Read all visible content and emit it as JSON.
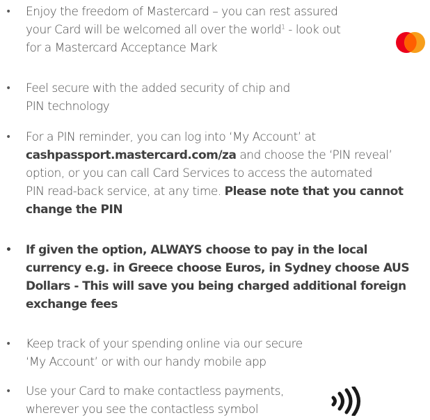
{
  "items": [
    {
      "lines": [
        "Enjoy the freedom of Mastercard – you can rest assured",
        "your Card will be welcomed all over the world",
        "for a Mastercard Acceptance Mark"
      ],
      "sup": "1",
      "after_sup": " - look out"
    },
    {
      "lines": [
        "Feel secure with the added security of chip and",
        "PIN technology"
      ]
    },
    {
      "line1": "For a PIN reminder, you can log into ‘My Account’ at",
      "link": "cashpassport.mastercard.com/za",
      "line2_rest": " and choose the ‘PIN reveal’",
      "line3": "option, or you can call Card Services to access the automated",
      "line4_pre": "PIN read-back service, at any time. ",
      "line4_bold": "Please note that you cannot",
      "line5_bold": "change the PIN"
    },
    {
      "lines": [
        "If given the option, ALWAYS choose to pay in the local",
        "currency e.g. in Greece choose Euros, in Sydney choose AUS",
        "Dollars - This will save you being charged additional foreign",
        "exchange fees"
      ]
    },
    {
      "lines": [
        "Keep track of your spending online via our secure",
        "‘My Account’ or with our handy mobile app"
      ]
    },
    {
      "lines": [
        "Use your Card to make contactless payments,",
        "wherever you see the contactless symbol"
      ]
    }
  ],
  "bullet": "•",
  "colors": {
    "text": "#4a4a4a",
    "mastercard_red": "#eb001b",
    "mastercard_orange": "#f79e1b",
    "mastercard_overlap": "#ff5f00",
    "contactless": "#1a1a1a"
  },
  "icons": {
    "mastercard": "mastercard-logo-icon",
    "contactless": "contactless-symbol-icon"
  }
}
